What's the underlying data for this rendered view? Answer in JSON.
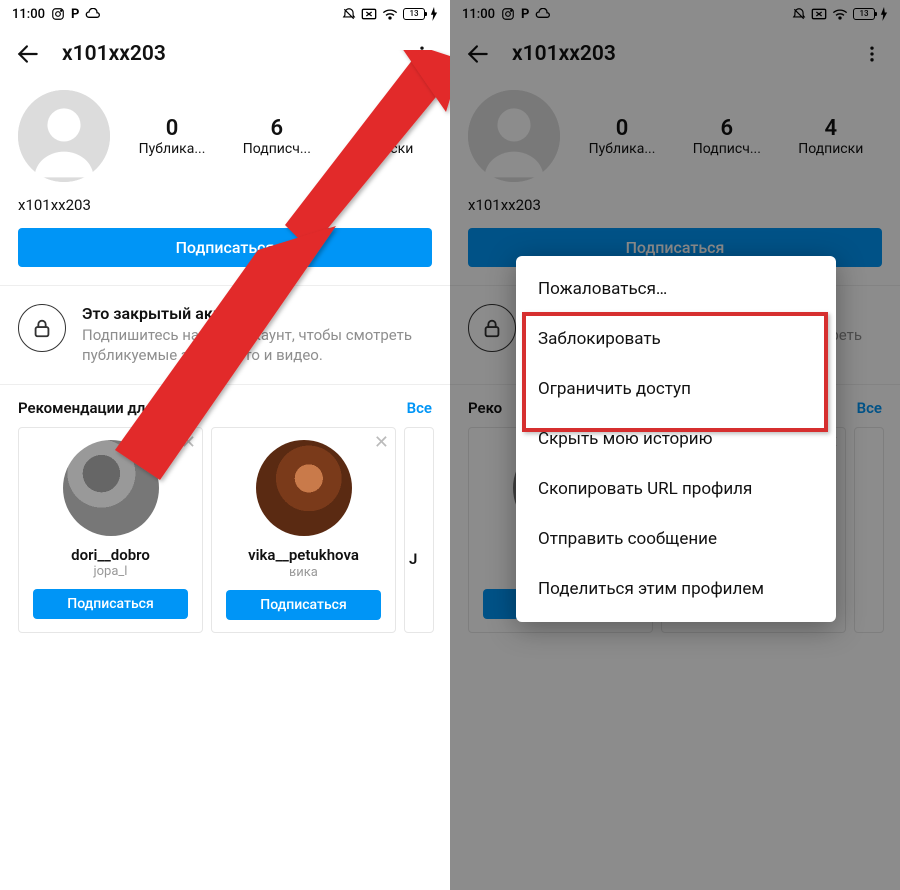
{
  "status": {
    "time": "11:00",
    "battery_text": "13"
  },
  "header": {
    "username": "x101xx203"
  },
  "stats": {
    "posts_count": "0",
    "posts_label": "Публика...",
    "followers_count": "6",
    "followers_label": "Подписч...",
    "following_count": "4",
    "following_label": "Подписки"
  },
  "profile": {
    "name": "x101xx203",
    "follow_button": "Подписаться"
  },
  "private": {
    "title": "Это закрытый аккаунт",
    "desc": "Подпишитесь на этот аккаунт, чтобы смотреть публикуемые здесь фото и видео."
  },
  "reco": {
    "title": "Рекомендации для вас",
    "title_short": "Реко",
    "all": "Все",
    "follow_label": "Подписаться",
    "cards": [
      {
        "username": "dori__dobro",
        "subtitle": "jopa_l"
      },
      {
        "username": "vika__petukhova",
        "subtitle": "ʁика"
      },
      {
        "username": "J",
        "subtitle": ""
      }
    ]
  },
  "menu": {
    "items": [
      "Пожаловаться…",
      "Заблокировать",
      "Ограничить доступ",
      "Скрыть мою историю",
      "Скопировать URL профиля",
      "Отправить сообщение",
      "Поделиться этим профилем"
    ]
  }
}
